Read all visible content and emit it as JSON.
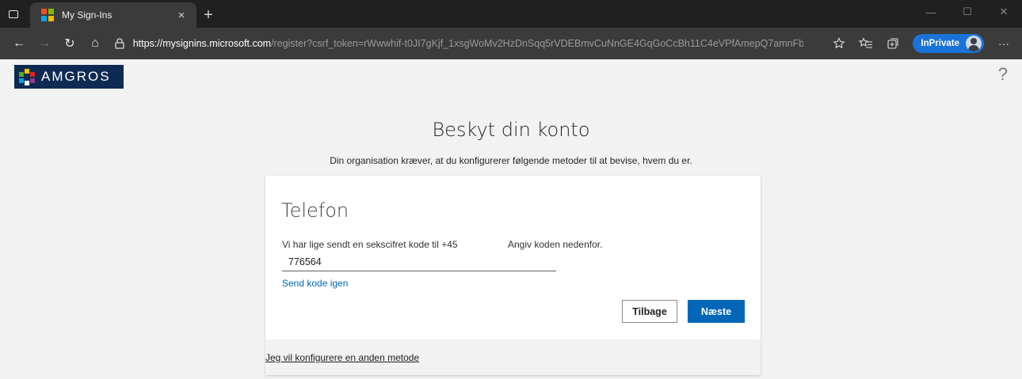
{
  "browser": {
    "tab_title": "My Sign-Ins",
    "tab_close": "×",
    "new_tab": "+",
    "window_controls": {
      "minimize": "—",
      "maximize": "☐",
      "close": "✕"
    },
    "nav": {
      "back": "←",
      "forward": "→",
      "refresh": "↻",
      "home": "⌂"
    },
    "url_scheme": "https://",
    "url_host": "mysignins.microsoft.com",
    "url_path": "/register?csrf_token=rWwwhif-t0JI7gKjf_1xsgWoMv2HzDnSqq5rVDEBmvCuNnGE4GqGoCcBh11C4eVPfAmepQ7amnFb2...",
    "inprivate_label": "InPrivate",
    "more_label": "···"
  },
  "header": {
    "logo_text": "AMGROS",
    "help": "?"
  },
  "page": {
    "title": "Beskyt din konto",
    "subtitle": "Din organisation kræver, at du konfigurerer følgende metoder til at bevise, hvem du er."
  },
  "card": {
    "title": "Telefon",
    "instruction_left": "Vi har lige sendt en sekscifret kode til +45",
    "instruction_right": "Angiv koden nedenfor.",
    "code_value": "776564",
    "resend_link": "Send kode igen",
    "back_button": "Tilbage",
    "next_button": "Næste",
    "alt_method_link": "Jeg vil konfigurere en anden metode"
  },
  "colors": {
    "accent": "#0067b8",
    "logo_bg": "#0d2b52",
    "inprivate": "#1a73d9"
  }
}
